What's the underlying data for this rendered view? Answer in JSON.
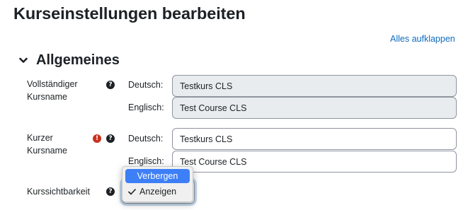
{
  "page": {
    "title": "Kurseinstellungen bearbeiten"
  },
  "toolbar": {
    "expand_all_label": "Alles aufklappen"
  },
  "section": {
    "title": "Allgemeines",
    "icon": "chevron-down-icon"
  },
  "fields": {
    "fullname": {
      "label": "Vollständiger Kursname",
      "help_icon": "question-circle-icon",
      "rows": [
        {
          "lang": "Deutsch:",
          "value": "Testkurs CLS"
        },
        {
          "lang": "Englisch:",
          "value": "Test Course CLS"
        }
      ]
    },
    "shortname": {
      "label": "Kurzer Kursname",
      "required_icon": "exclamation-circle-icon",
      "help_icon": "question-circle-icon",
      "rows": [
        {
          "lang": "Deutsch:",
          "value": "Testkurs CLS"
        },
        {
          "lang": "Englisch:",
          "value": "Test Course CLS"
        }
      ]
    },
    "visibility": {
      "label": "Kurssichtbarkeit",
      "help_icon": "question-circle-icon",
      "options": [
        {
          "label": "Verbergen",
          "highlighted": true
        },
        {
          "label": "Anzeigen",
          "selected": true
        }
      ]
    }
  },
  "colors": {
    "text": "#1d2125",
    "link": "#0f6cbf",
    "required": "#ca3120",
    "readonly_bg": "#e9ecef",
    "highlight": "#3d7ff6"
  }
}
